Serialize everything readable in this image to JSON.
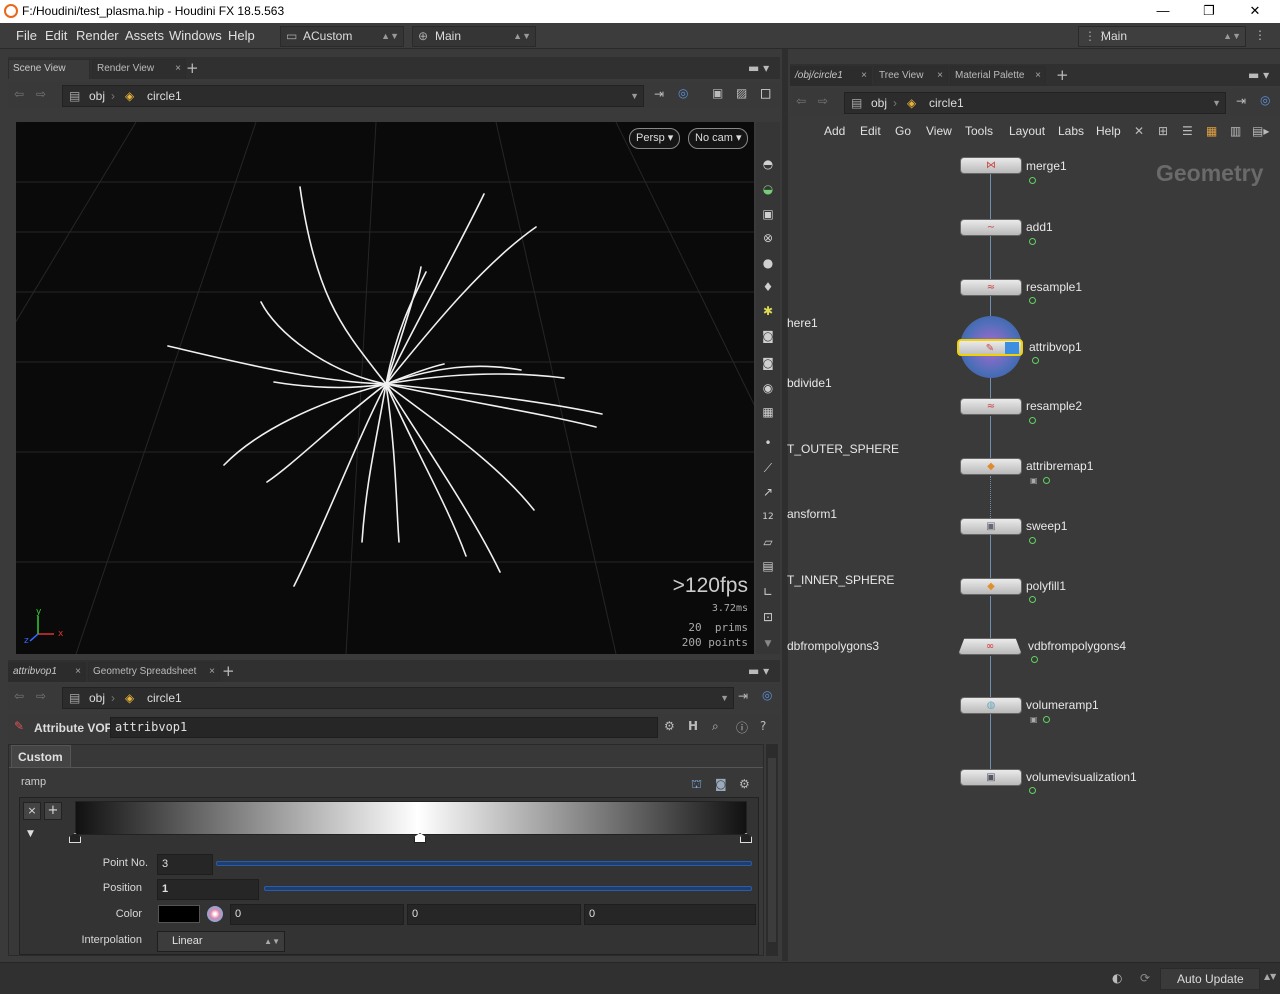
{
  "window": {
    "title": "F:/Houdini/test_plasma.hip - Houdini FX 18.5.563",
    "minimize": "—",
    "restore": "❐",
    "close": "✕"
  },
  "menu": {
    "items": [
      "File",
      "Edit",
      "Render",
      "Assets",
      "Windows",
      "Help"
    ],
    "desktop": "ACustom",
    "shelf": "Main",
    "right_desktop": "Main"
  },
  "left_tabs": {
    "tab1": "Scene View",
    "tab2": "Render View"
  },
  "path": {
    "root": "obj",
    "node": "circle1"
  },
  "viewport": {
    "persp": "Persp",
    "cam": "No cam",
    "fps": ">120fps",
    "ms": "3.72ms",
    "prims": "20  prims",
    "points": "200 points",
    "axis_x": "x",
    "axis_y": "y",
    "axis_z": "z"
  },
  "right_tabs": {
    "tab1": "/obj/circle1",
    "tab2": "Tree View",
    "tab3": "Material Palette"
  },
  "network_menu": [
    "Add",
    "Edit",
    "Go",
    "View",
    "Tools",
    "Layout",
    "Labs",
    "Help"
  ],
  "network": {
    "context": "Geometry",
    "nodes": [
      "merge1",
      "add1",
      "resample1",
      "attribvop1",
      "resample2",
      "attribremap1",
      "sweep1",
      "polyfill1",
      "vdbfrompolygons4",
      "volumeramp1",
      "volumevisualization1"
    ],
    "edge_labels": [
      "here1",
      "bdivide1",
      "T_OUTER_SPHERE",
      "ansform1",
      "T_INNER_SPHERE",
      "dbfrompolygons3"
    ]
  },
  "params_tabs": {
    "tab1": "attribvop1",
    "tab2": "Geometry Spreadsheet"
  },
  "params": {
    "op_type": "Attribute VOP",
    "op_name": "attribvop1",
    "folder": "Custom",
    "ramp_label": "ramp",
    "point_no_label": "Point No.",
    "point_no": "3",
    "position_label": "Position",
    "position": "1",
    "color_label": "Color",
    "color_r": "0",
    "color_g": "0",
    "color_b": "0",
    "interp_label": "Interpolation",
    "interp": "Linear"
  },
  "status": {
    "auto_update": "Auto Update"
  },
  "colors": {
    "accent": "#e8671a",
    "wire": "#6f8fae",
    "selected": "#f2d100",
    "flag": "#5fd35f"
  }
}
